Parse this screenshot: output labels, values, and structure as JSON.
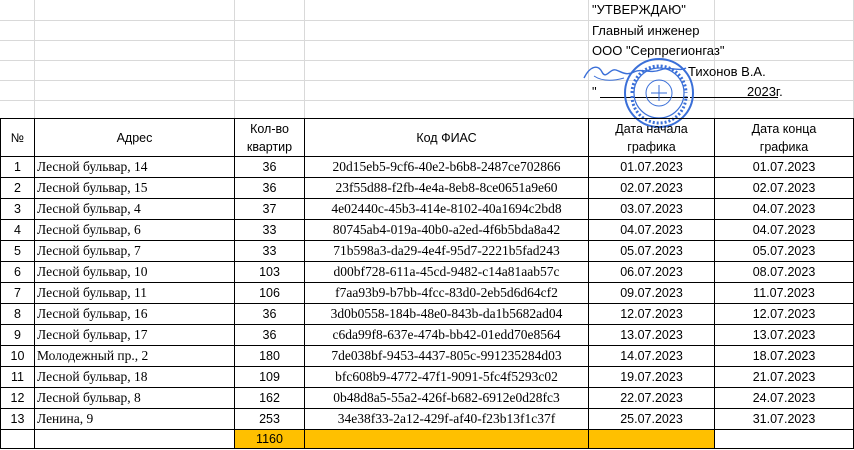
{
  "approval": {
    "line1": "\"УТВЕРЖДАЮ\"",
    "line2": "Главный инженер",
    "line3": "ООО \"Серпрегионгаз\"",
    "signer": "Тихонов В.А.",
    "date_quote": "\"",
    "year": "2023г."
  },
  "stamp": {
    "icon": "round-seal-stamp",
    "color": "#3a6fd8"
  },
  "table": {
    "headers": {
      "num": "№",
      "address": "Адрес",
      "count_l1": "Кол-во",
      "count_l2": "квартир",
      "fias": "Код ФИАС",
      "start_l1": "Дата начала",
      "start_l2": "графика",
      "end_l1": "Дата конца",
      "end_l2": "графика"
    },
    "rows": [
      {
        "num": "1",
        "address": "Лесной бульвар, 14",
        "count": "36",
        "fias": "20d15eb5-9cf6-40e2-b6b8-2487ce702866",
        "start": "01.07.2023",
        "end": "01.07.2023"
      },
      {
        "num": "2",
        "address": "Лесной бульвар, 15",
        "count": "36",
        "fias": "23f55d88-f2fb-4e4a-8eb8-8ce0651a9e60",
        "start": "02.07.2023",
        "end": "02.07.2023"
      },
      {
        "num": "3",
        "address": "Лесной бульвар, 4",
        "count": "37",
        "fias": "4e02440c-45b3-414e-8102-40a1694c2bd8",
        "start": "03.07.2023",
        "end": "04.07.2023"
      },
      {
        "num": "4",
        "address": "Лесной бульвар, 6",
        "count": "33",
        "fias": "80745ab4-019a-40b0-a2ed-4f6b5bda8a42",
        "start": "04.07.2023",
        "end": "04.07.2023"
      },
      {
        "num": "5",
        "address": "Лесной бульвар, 7",
        "count": "33",
        "fias": "71b598a3-da29-4e4f-95d7-2221b5fad243",
        "start": "05.07.2023",
        "end": "05.07.2023"
      },
      {
        "num": "6",
        "address": "Лесной бульвар, 10",
        "count": "103",
        "fias": "d00bf728-611a-45cd-9482-c14a81aab57c",
        "start": "06.07.2023",
        "end": "08.07.2023"
      },
      {
        "num": "7",
        "address": "Лесной бульвар, 11",
        "count": "106",
        "fias": "f7aa93b9-b7bb-4fcc-83d0-2eb5d6d64cf2",
        "start": "09.07.2023",
        "end": "11.07.2023"
      },
      {
        "num": "8",
        "address": "Лесной бульвар, 16",
        "count": "36",
        "fias": "3d0b0558-184b-48e0-843b-da1b5682ad04",
        "start": "12.07.2023",
        "end": "12.07.2023"
      },
      {
        "num": "9",
        "address": "Лесной бульвар, 17",
        "count": "36",
        "fias": "c6da99f8-637e-474b-bb42-01edd70e8564",
        "start": "13.07.2023",
        "end": "13.07.2023"
      },
      {
        "num": "10",
        "address": "Молодежный пр., 2",
        "count": "180",
        "fias": "7de038bf-9453-4437-805c-991235284d03",
        "start": "14.07.2023",
        "end": "18.07.2023"
      },
      {
        "num": "11",
        "address": "Лесной бульвар, 18",
        "count": "109",
        "fias": "bfc608b9-4772-47f1-9091-5fc4f5293c02",
        "start": "19.07.2023",
        "end": "21.07.2023"
      },
      {
        "num": "12",
        "address": "Лесной бульвар, 8",
        "count": "162",
        "fias": "0b48d8a5-55a2-426f-b682-6912e0d28fc3",
        "start": "22.07.2023",
        "end": "24.07.2023"
      },
      {
        "num": "13",
        "address": "Ленина, 9",
        "count": "253",
        "fias": "34e38f33-2a12-429f-af40-f23b13f1c37f",
        "start": "25.07.2023",
        "end": "31.07.2023"
      }
    ],
    "total": "1160"
  },
  "colors": {
    "highlight": "#ffc000",
    "gridline": "#d9d9d9"
  }
}
